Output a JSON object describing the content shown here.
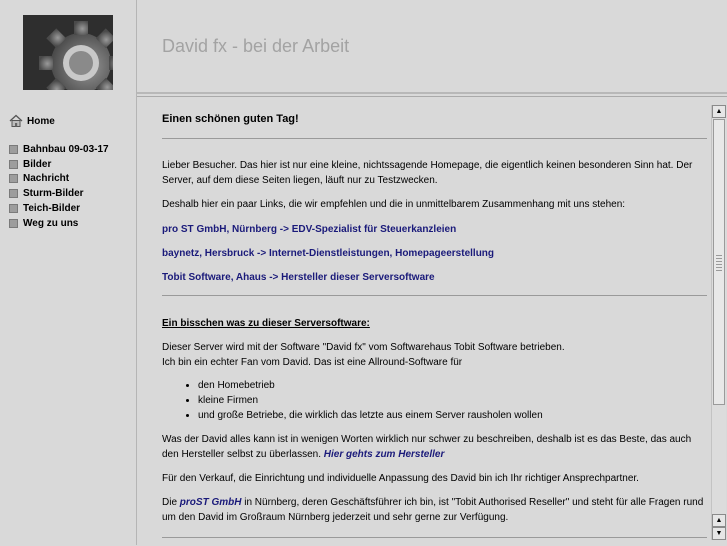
{
  "sidebar": {
    "home_label": "Home",
    "items": [
      {
        "label": "Bahnbau 09-03-17"
      },
      {
        "label": "Bilder"
      },
      {
        "label": "Nachricht"
      },
      {
        "label": "Sturm-Bilder"
      },
      {
        "label": "Teich-Bilder"
      },
      {
        "label": "Weg zu uns"
      }
    ]
  },
  "header": {
    "title": "David fx - bei der Arbeit"
  },
  "main": {
    "greeting": "Einen schönen guten Tag!",
    "intro": "Lieber Besucher. Das hier ist nur eine kleine, nichtssagende Homepage, die eigentlich keinen besonderen Sinn hat. Der Server, auf dem diese Seiten liegen, läuft nur zu Testzwecken.",
    "links_intro": "Deshalb hier ein paar Links, die wir empfehlen und die in unmittelbarem Zusammenhang mit uns stehen:",
    "links": [
      {
        "label": "pro ST GmbH, Nürnberg  ->  EDV-Spezialist für Steuerkanzleien"
      },
      {
        "label": "baynetz, Hersbruck  ->  Internet-Dienstleistungen, Homepageerstellung"
      },
      {
        "label": "Tobit Software, Ahaus -> Hersteller dieser Serversoftware"
      }
    ],
    "section_title": "Ein bisschen was zu dieser Serversoftware:",
    "software_p1_line1": "Dieser Server wird mit der Software \"David fx\" vom Softwarehaus Tobit Software betrieben.",
    "software_p1_line2": "Ich bin ein echter Fan vom David. Das ist eine Allround-Software für",
    "bullets": [
      "den Homebetrieb",
      "kleine Firmen",
      "und große Betriebe, die wirklich das letzte aus einem Server rausholen wollen"
    ],
    "software_p2": "Was der David alles kann ist in wenigen Worten wirklich nur schwer zu beschreiben, deshalb ist es das Beste, das auch den Hersteller selbst zu überlassen.",
    "hersteller_link": "Hier gehts zum Hersteller",
    "software_p3": "Für den Verkauf, die Einrichtung und individuelle Anpassung des David bin ich Ihr richtiger Ansprechpartner.",
    "software_p4_pre": "Die ",
    "software_p4_link": "proST GmbH",
    "software_p4_post": " in Nürnberg, deren Geschäftsführer ich bin, ist \"Tobit Authorised Reseller\" und steht für alle Fragen rund um den David im Großraum Nürnberg jederzeit und sehr gerne zur Verfügung."
  },
  "icons": {
    "home": "house-icon",
    "scroll_up": "arrow-up-icon",
    "scroll_down": "arrow-down-icon",
    "logo": "gear-icon"
  }
}
